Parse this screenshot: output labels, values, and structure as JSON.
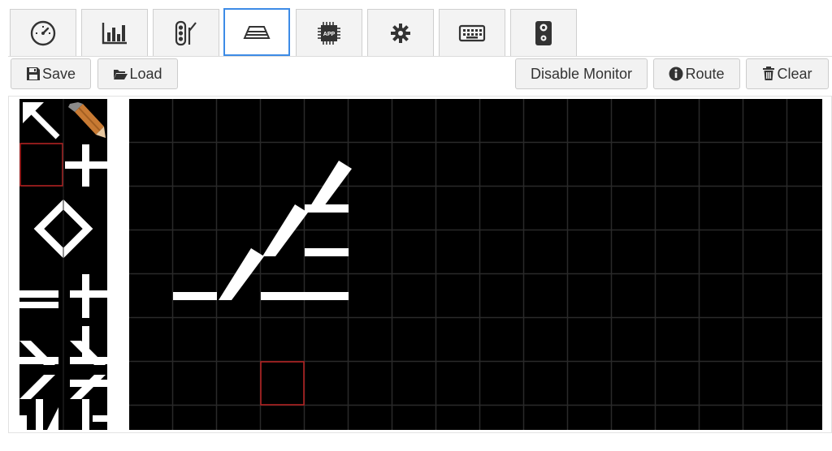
{
  "tabs": [
    {
      "name": "dashboard",
      "icon": "gauge-icon"
    },
    {
      "name": "statistics",
      "icon": "bar-chart-icon"
    },
    {
      "name": "signals",
      "icon": "traffic-light-icon"
    },
    {
      "name": "track-layout",
      "icon": "track-icon",
      "active": true
    },
    {
      "name": "app",
      "icon": "chip-app-icon",
      "chip_label": "APP"
    },
    {
      "name": "settings",
      "icon": "gear-icon"
    },
    {
      "name": "keyboard",
      "icon": "keyboard-icon"
    },
    {
      "name": "sound",
      "icon": "speaker-icon"
    }
  ],
  "toolbar": {
    "save_label": "Save",
    "load_label": "Load",
    "disable_monitor_label": "Disable Monitor",
    "route_label": "Route",
    "clear_label": "Clear"
  },
  "colors": {
    "grid_background": "#000000",
    "grid_line": "#2a2a2a",
    "track": "#ffffff",
    "selection": "#b22222",
    "active_tab_border": "#3d8be6"
  },
  "layout_grid": {
    "columns": 16,
    "rows": 8,
    "tracks": [
      {
        "type": "h",
        "col": 1,
        "row": 4
      },
      {
        "type": "diag-up",
        "col": 2,
        "row": 4
      },
      {
        "type": "h",
        "col": 3,
        "row": 4
      },
      {
        "type": "h",
        "col": 4,
        "row": 4
      },
      {
        "type": "diag-up",
        "col": 3,
        "row": 3
      },
      {
        "type": "h",
        "col": 4,
        "row": 3
      },
      {
        "type": "diag-up",
        "col": 4,
        "row": 2
      },
      {
        "type": "h",
        "col": 4,
        "row": 2
      }
    ],
    "selected_cell": {
      "col": 3,
      "row": 6
    }
  }
}
